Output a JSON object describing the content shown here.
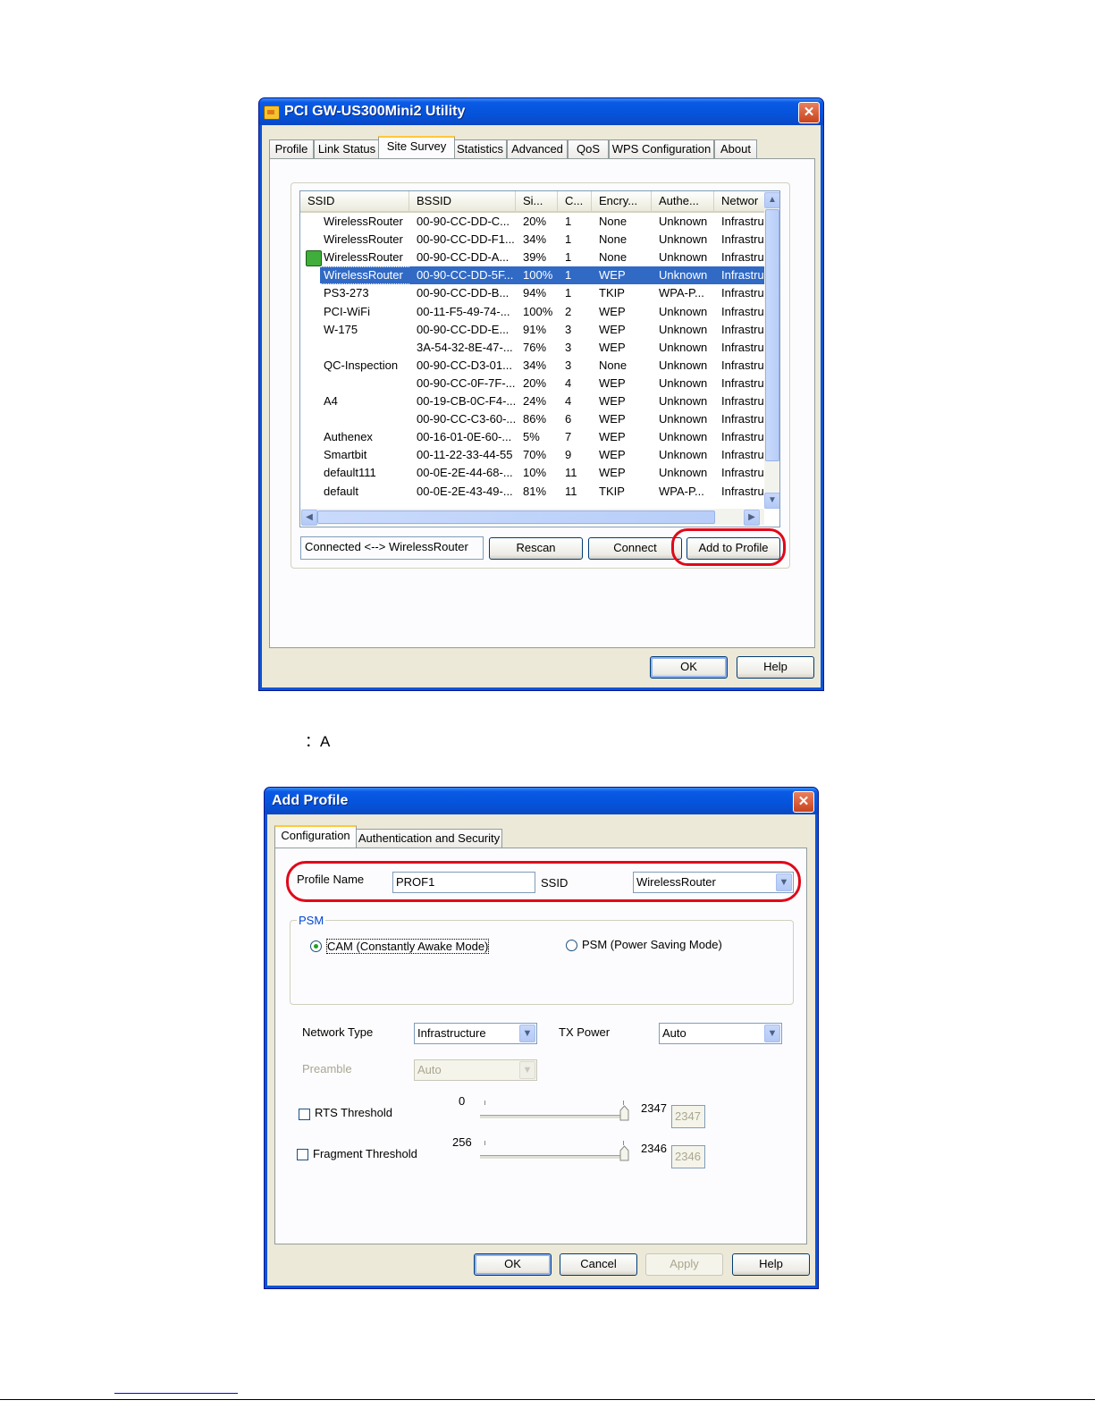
{
  "utility": {
    "title": "PCI GW-US300Mini2 Utility",
    "close": "✕",
    "tabs": [
      "Profile",
      "Link Status",
      "Site Survey",
      "Statistics",
      "Advanced",
      "QoS",
      "WPS Configuration",
      "About"
    ],
    "active_tab": "Site Survey",
    "columns": [
      "SSID",
      "BSSID",
      "Si...",
      "C...",
      "Encry...",
      "Authe...",
      "Networ"
    ],
    "rows": [
      {
        "ssid": "WirelessRouter",
        "bssid": "00-90-CC-DD-C...",
        "signal": "20%",
        "channel": "1",
        "enc": "None",
        "auth": "Unknown",
        "net": "Infrastru"
      },
      {
        "ssid": "WirelessRouter",
        "bssid": "00-90-CC-DD-F1...",
        "signal": "34%",
        "channel": "1",
        "enc": "None",
        "auth": "Unknown",
        "net": "Infrastru"
      },
      {
        "ssid": "WirelessRouter",
        "bssid": "00-90-CC-DD-A...",
        "signal": "39%",
        "channel": "1",
        "enc": "None",
        "auth": "Unknown",
        "net": "Infrastru"
      },
      {
        "ssid": "WirelessRouter",
        "bssid": "00-90-CC-DD-5F...",
        "signal": "100%",
        "channel": "1",
        "enc": "WEP",
        "auth": "Unknown",
        "net": "Infrastru"
      },
      {
        "ssid": "PS3-273",
        "bssid": "00-90-CC-DD-B...",
        "signal": "94%",
        "channel": "1",
        "enc": "TKIP",
        "auth": "WPA-P...",
        "net": "Infrastru"
      },
      {
        "ssid": "PCI-WiFi",
        "bssid": "00-11-F5-49-74-...",
        "signal": "100%",
        "channel": "2",
        "enc": "WEP",
        "auth": "Unknown",
        "net": "Infrastru"
      },
      {
        "ssid": "W-175",
        "bssid": "00-90-CC-DD-E...",
        "signal": "91%",
        "channel": "3",
        "enc": "WEP",
        "auth": "Unknown",
        "net": "Infrastru"
      },
      {
        "ssid": "",
        "bssid": "3A-54-32-8E-47-...",
        "signal": "76%",
        "channel": "3",
        "enc": "WEP",
        "auth": "Unknown",
        "net": "Infrastru"
      },
      {
        "ssid": "QC-Inspection",
        "bssid": "00-90-CC-D3-01...",
        "signal": "34%",
        "channel": "3",
        "enc": "None",
        "auth": "Unknown",
        "net": "Infrastru"
      },
      {
        "ssid": "",
        "bssid": "00-90-CC-0F-7F-...",
        "signal": "20%",
        "channel": "4",
        "enc": "WEP",
        "auth": "Unknown",
        "net": "Infrastru"
      },
      {
        "ssid": "A4",
        "bssid": "00-19-CB-0C-F4-...",
        "signal": "24%",
        "channel": "4",
        "enc": "WEP",
        "auth": "Unknown",
        "net": "Infrastru"
      },
      {
        "ssid": "",
        "bssid": "00-90-CC-C3-60-...",
        "signal": "86%",
        "channel": "6",
        "enc": "WEP",
        "auth": "Unknown",
        "net": "Infrastru"
      },
      {
        "ssid": "Authenex",
        "bssid": "00-16-01-0E-60-...",
        "signal": "5%",
        "channel": "7",
        "enc": "WEP",
        "auth": "Unknown",
        "net": "Infrastru"
      },
      {
        "ssid": "Smartbit",
        "bssid": "00-11-22-33-44-55",
        "signal": "70%",
        "channel": "9",
        "enc": "WEP",
        "auth": "Unknown",
        "net": "Infrastru"
      },
      {
        "ssid": "default111",
        "bssid": "00-0E-2E-44-68-...",
        "signal": "10%",
        "channel": "11",
        "enc": "WEP",
        "auth": "Unknown",
        "net": "Infrastru"
      },
      {
        "ssid": "default",
        "bssid": "00-0E-2E-43-49-...",
        "signal": "81%",
        "channel": "11",
        "enc": "TKIP",
        "auth": "WPA-P...",
        "net": "Infrastru"
      }
    ],
    "selected_row": 3,
    "connected_row": 2,
    "status": "Connected <--> WirelessRouter",
    "buttons": {
      "rescan": "Rescan",
      "connect": "Connect",
      "add_to_profile": "Add to Profile",
      "ok": "OK",
      "help": "Help"
    }
  },
  "caption": "：A",
  "add_profile": {
    "title": "Add Profile",
    "close": "✕",
    "tabs": [
      "Configuration",
      "Authentication and Security"
    ],
    "profile_name_label": "Profile Name",
    "profile_name_value": "PROF1",
    "ssid_label": "SSID",
    "ssid_value": "WirelessRouter",
    "psm_group": "PSM",
    "cam_label": "CAM (Constantly Awake Mode)",
    "psm_label": "PSM (Power Saving Mode)",
    "network_type_label": "Network Type",
    "network_type_value": "Infrastructure",
    "tx_power_label": "TX Power",
    "tx_power_value": "Auto",
    "preamble_label": "Preamble",
    "preamble_value": "Auto",
    "rts_label": "RTS Threshold",
    "rts_min": "0",
    "rts_max": "2347",
    "rts_value": "2347",
    "frag_label": "Fragment Threshold",
    "frag_min": "256",
    "frag_max": "2346",
    "frag_value": "2346",
    "buttons": {
      "ok": "OK",
      "cancel": "Cancel",
      "apply": "Apply",
      "help": "Help"
    }
  },
  "colors": {
    "highlight": "#316ac5",
    "annotation_ring": "#e0081a",
    "xp_title": "#0553da"
  }
}
